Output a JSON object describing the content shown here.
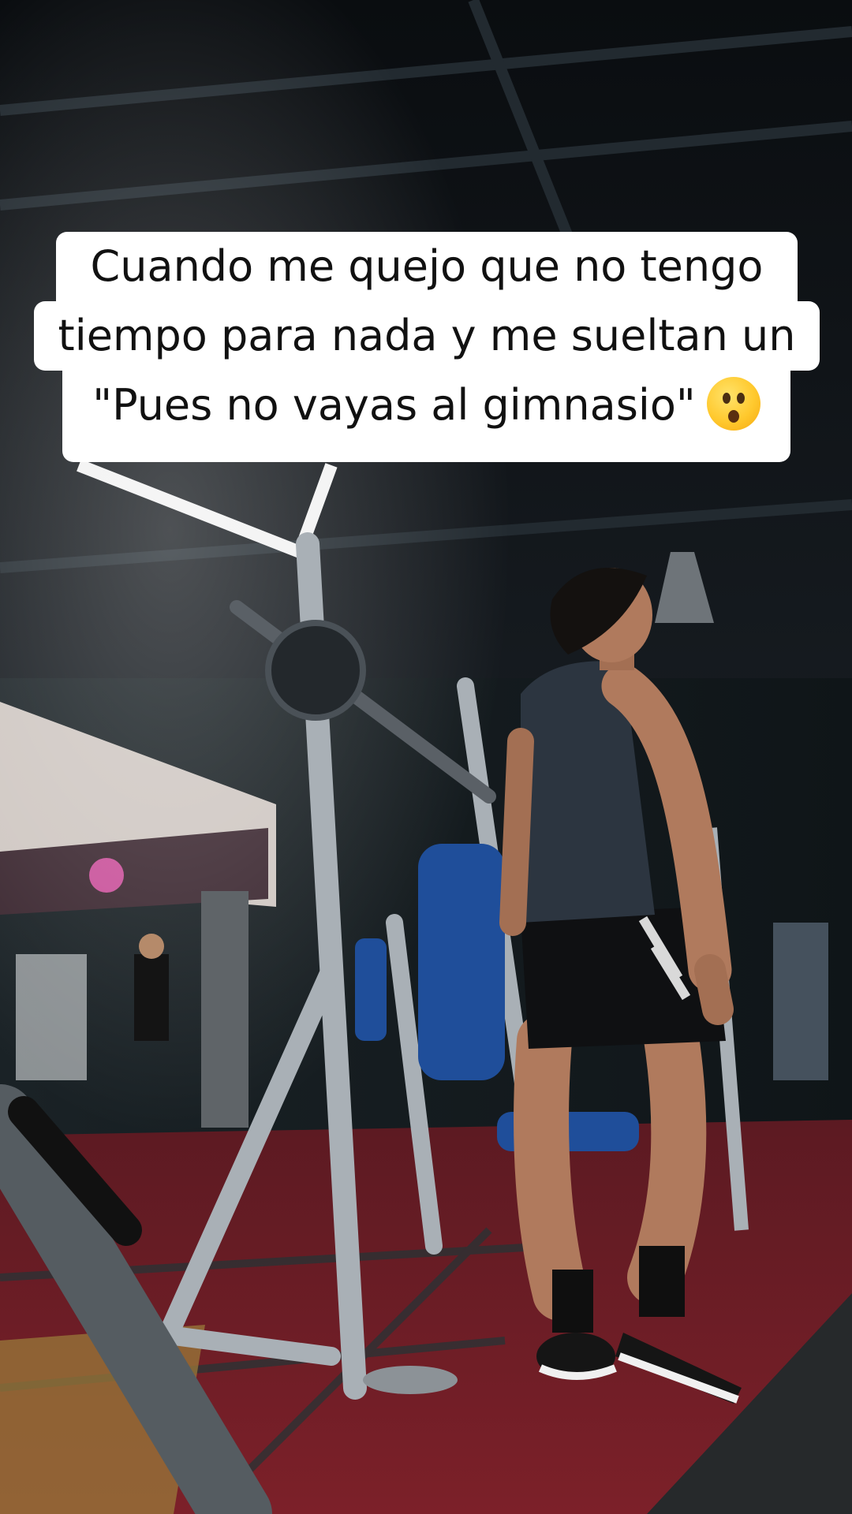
{
  "caption": {
    "line1": "Cuando me quejo que no tengo",
    "line2": "tiempo para nada y me sueltan un",
    "line3": "\"Pues no vayas al gimnasio\"",
    "emoji": "astonished-face-emoji"
  },
  "scene": {
    "description_icons": [
      "gym-scene",
      "man-figure",
      "smith-machine",
      "weight-bench"
    ],
    "colors": {
      "ceiling": "#101418",
      "floor_red": "#7a1f28",
      "floor_yellow": "#9a7a3a",
      "bench_blue": "#1f4e9a",
      "metal": "#a9b0b6"
    }
  }
}
